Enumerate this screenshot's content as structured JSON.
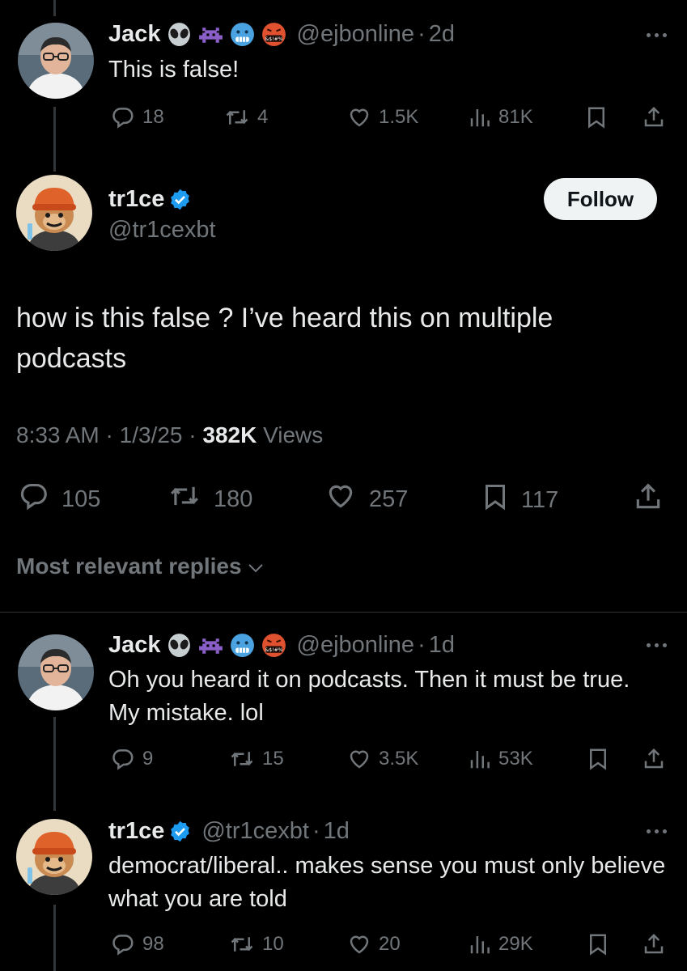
{
  "colors": {
    "background": "#000000",
    "text": "#e7e9ea",
    "muted": "#71767b",
    "verified": "#1d9bf0",
    "follow_bg": "#eff3f4"
  },
  "tweet1": {
    "name": "Jack",
    "emojis": [
      "alien-emoji",
      "space-invader-emoji",
      "cold-face-emoji",
      "cursing-face-emoji"
    ],
    "handle": "@ejbonline",
    "time": "2d",
    "text": "This is false!",
    "replies": "18",
    "reposts": "4",
    "likes": "1.5K",
    "views": "81K"
  },
  "main": {
    "name": "tr1ce",
    "handle": "@tr1cexbt",
    "follow_label": "Follow",
    "text": "how is this false ? I’ve heard this on multiple podcasts",
    "time": "8:33 AM",
    "date": "1/3/25",
    "views_count": "382K",
    "views_label": "Views",
    "replies": "105",
    "reposts": "180",
    "likes": "257",
    "bookmarks": "117"
  },
  "sort_label": "Most relevant replies",
  "reply1": {
    "name": "Jack",
    "handle": "@ejbonline",
    "time": "1d",
    "text": "Oh you heard it on podcasts. Then it must be true.  My mistake.  lol",
    "replies": "9",
    "reposts": "15",
    "likes": "3.5K",
    "views": "53K"
  },
  "reply2": {
    "name": "tr1ce",
    "handle": "@tr1cexbt",
    "time": "1d",
    "text": "democrat/liberal.. makes sense you must only believe what you are told",
    "replies": "98",
    "reposts": "10",
    "likes": "20",
    "views": "29K"
  },
  "separator": "·"
}
